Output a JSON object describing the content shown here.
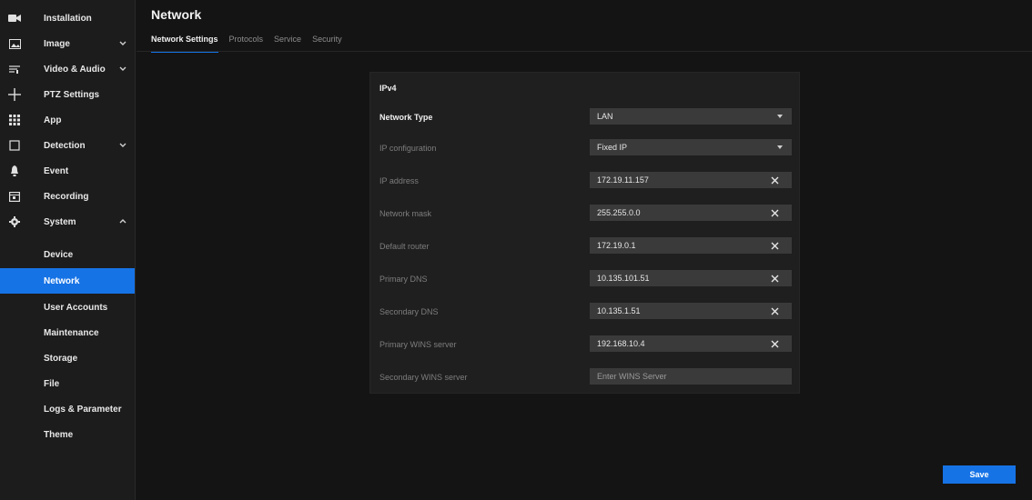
{
  "sidebar": {
    "items": [
      {
        "label": "Installation",
        "icon": "camera-icon"
      },
      {
        "label": "Image",
        "icon": "image-icon"
      },
      {
        "label": "Video & Audio",
        "icon": "equalizer-icon"
      },
      {
        "label": "PTZ Settings",
        "icon": "ptz-icon"
      },
      {
        "label": "App",
        "icon": "apps-grid-icon"
      },
      {
        "label": "Detection",
        "icon": "detection-frame-icon"
      },
      {
        "label": "Event",
        "icon": "bell-icon"
      },
      {
        "label": "Recording",
        "icon": "calendar-icon"
      },
      {
        "label": "System",
        "icon": "gear-icon"
      }
    ],
    "system_subitems": [
      "Device",
      "Network",
      "User Accounts",
      "Maintenance",
      "Storage",
      "File",
      "Logs & Parameter",
      "Theme"
    ],
    "active_subitem": "Network"
  },
  "header": {
    "title": "Network",
    "tabs": [
      "Network Settings",
      "Protocols",
      "Service",
      "Security"
    ],
    "active_tab": "Network Settings"
  },
  "panel": {
    "section_title": "IPv4",
    "network_type": {
      "label": "Network Type",
      "value": "LAN"
    },
    "ip_configuration": {
      "label": "IP configuration",
      "value": "Fixed IP"
    },
    "ip_address": {
      "label": "IP address",
      "value": "172.19.11.157"
    },
    "network_mask": {
      "label": "Network mask",
      "value": "255.255.0.0"
    },
    "default_router": {
      "label": "Default router",
      "value": "172.19.0.1"
    },
    "primary_dns": {
      "label": "Primary DNS",
      "value": "10.135.101.51"
    },
    "secondary_dns": {
      "label": "Secondary DNS",
      "value": "10.135.1.51"
    },
    "primary_wins": {
      "label": "Primary WINS server",
      "value": "192.168.10.4"
    },
    "secondary_wins": {
      "label": "Secondary WINS server",
      "value": "",
      "placeholder": "Enter WINS Server"
    }
  },
  "footer": {
    "save_label": "Save"
  },
  "colors": {
    "accent": "#1673e6",
    "background": "#141414",
    "sidebar": "#1c1c1c",
    "panel": "#1f1f1f",
    "field": "#3a3a3a"
  }
}
